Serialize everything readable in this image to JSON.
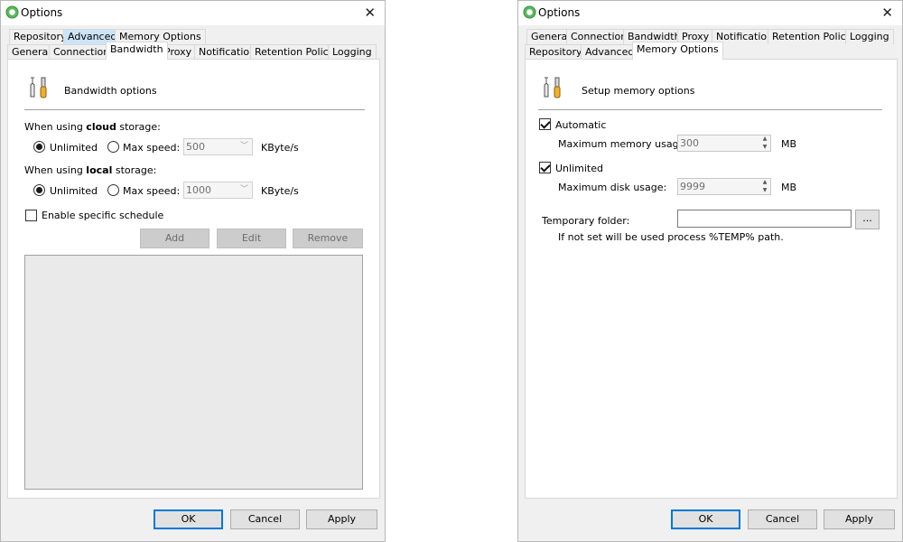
{
  "window_left": {
    "title": "Options",
    "tabs_row1": [
      "Repository",
      "Advanced",
      "Memory Options"
    ],
    "tabs_row2": [
      "General",
      "Connection",
      "Bandwidth",
      "Proxy",
      "Notification",
      "Retention Policy",
      "Logging"
    ],
    "selected_tab": "Bandwidth",
    "section_title": "Bandwidth options",
    "cloud": {
      "prefix": "When using",
      "keyword": "cloud",
      "suffix": "storage:",
      "unlimited_label": "Unlimited",
      "maxspeed_label": "Max speed:",
      "maxspeed_value": "500",
      "unit": "KByte/s",
      "selected": "Unlimited"
    },
    "local": {
      "prefix": "When using",
      "keyword": "local",
      "suffix": "storage:",
      "unlimited_label": "Unlimited",
      "maxspeed_label": "Max speed:",
      "maxspeed_value": "1000",
      "unit": "KByte/s",
      "selected": "Unlimited"
    },
    "schedule_label": "Enable specific schedule",
    "schedule_checked": false,
    "add_label": "Add",
    "edit_label": "Edit",
    "remove_label": "Remove",
    "ok_label": "OK",
    "cancel_label": "Cancel",
    "apply_label": "Apply"
  },
  "window_right": {
    "title": "Options",
    "tabs_row1": [
      "General",
      "Connection",
      "Bandwidth",
      "Proxy",
      "Notification",
      "Retention Policy",
      "Logging"
    ],
    "tabs_row2": [
      "Repository",
      "Advanced",
      "Memory Options"
    ],
    "selected_tab": "Memory Options",
    "section_title": "Setup memory options",
    "automatic_label": "Automatic",
    "automatic_checked": true,
    "max_memory_label": "Maximum memory usage:",
    "max_memory_value": "300",
    "max_memory_unit": "MB",
    "unlimited_label": "Unlimited",
    "unlimited_checked": true,
    "max_disk_label": "Maximum disk usage:",
    "max_disk_value": "9999",
    "max_disk_unit": "MB",
    "temp_folder_label": "Temporary folder:",
    "temp_folder_value": "",
    "browse_label": "...",
    "temp_hint": "If not set will be used process %TEMP% path.",
    "ok_label": "OK",
    "cancel_label": "Cancel",
    "apply_label": "Apply"
  },
  "icons": {
    "app": "app-logo-icon",
    "tools": "tools-icon",
    "close": "close-icon"
  }
}
